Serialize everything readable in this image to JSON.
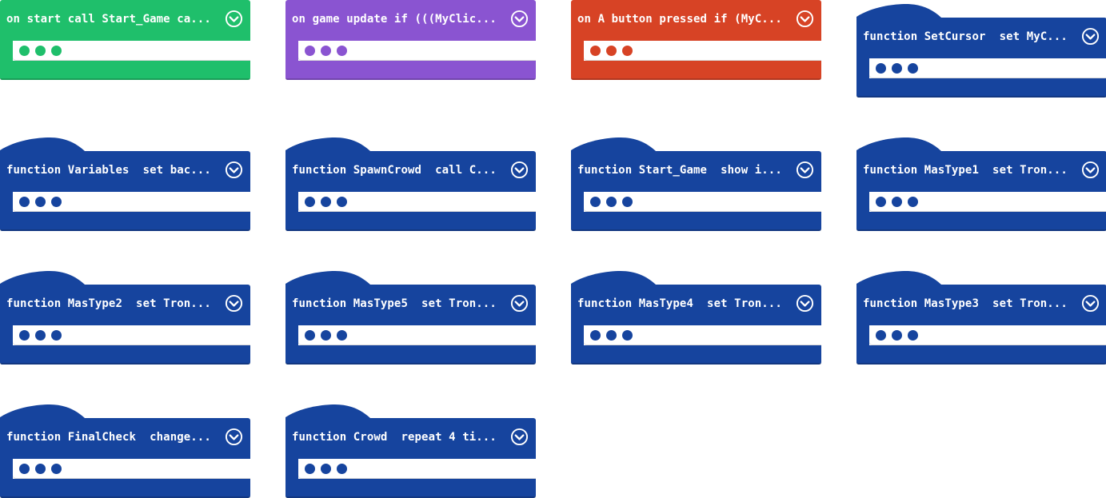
{
  "workspace": {
    "background": "#ffffff",
    "blocks": [
      {
        "label": "on start call Start_Game ca...",
        "color": "#1fbf6b",
        "hat": false,
        "expand_icon": "chevron-down-circle-icon"
      },
      {
        "label": "on game update if (((MyClic...",
        "color": "#8a54d1",
        "hat": false,
        "expand_icon": "chevron-down-circle-icon"
      },
      {
        "label": "on A button pressed if (MyC...",
        "color": "#d74325",
        "hat": false,
        "expand_icon": "chevron-down-circle-icon"
      },
      {
        "label": "function SetCursor  set MyC...",
        "color": "#16449e",
        "hat": true,
        "expand_icon": "chevron-down-circle-icon"
      },
      {
        "label": "function Variables  set bac...",
        "color": "#16449e",
        "hat": true,
        "expand_icon": "chevron-down-circle-icon"
      },
      {
        "label": "function SpawnCrowd  call C...",
        "color": "#16449e",
        "hat": true,
        "expand_icon": "chevron-down-circle-icon"
      },
      {
        "label": "function Start_Game  show i...",
        "color": "#16449e",
        "hat": true,
        "expand_icon": "chevron-down-circle-icon"
      },
      {
        "label": "function MasType1  set Tron...",
        "color": "#16449e",
        "hat": true,
        "expand_icon": "chevron-down-circle-icon"
      },
      {
        "label": "function MasType2  set Tron...",
        "color": "#16449e",
        "hat": true,
        "expand_icon": "chevron-down-circle-icon"
      },
      {
        "label": "function MasType5  set Tron...",
        "color": "#16449e",
        "hat": true,
        "expand_icon": "chevron-down-circle-icon"
      },
      {
        "label": "function MasType4  set Tron...",
        "color": "#16449e",
        "hat": true,
        "expand_icon": "chevron-down-circle-icon"
      },
      {
        "label": "function MasType3  set Tron...",
        "color": "#16449e",
        "hat": true,
        "expand_icon": "chevron-down-circle-icon"
      },
      {
        "label": "function FinalCheck  change...",
        "color": "#16449e",
        "hat": true,
        "expand_icon": "chevron-down-circle-icon"
      },
      {
        "label": "function Crowd  repeat 4 ti...",
        "color": "#16449e",
        "hat": true,
        "expand_icon": "chevron-down-circle-icon"
      }
    ]
  }
}
